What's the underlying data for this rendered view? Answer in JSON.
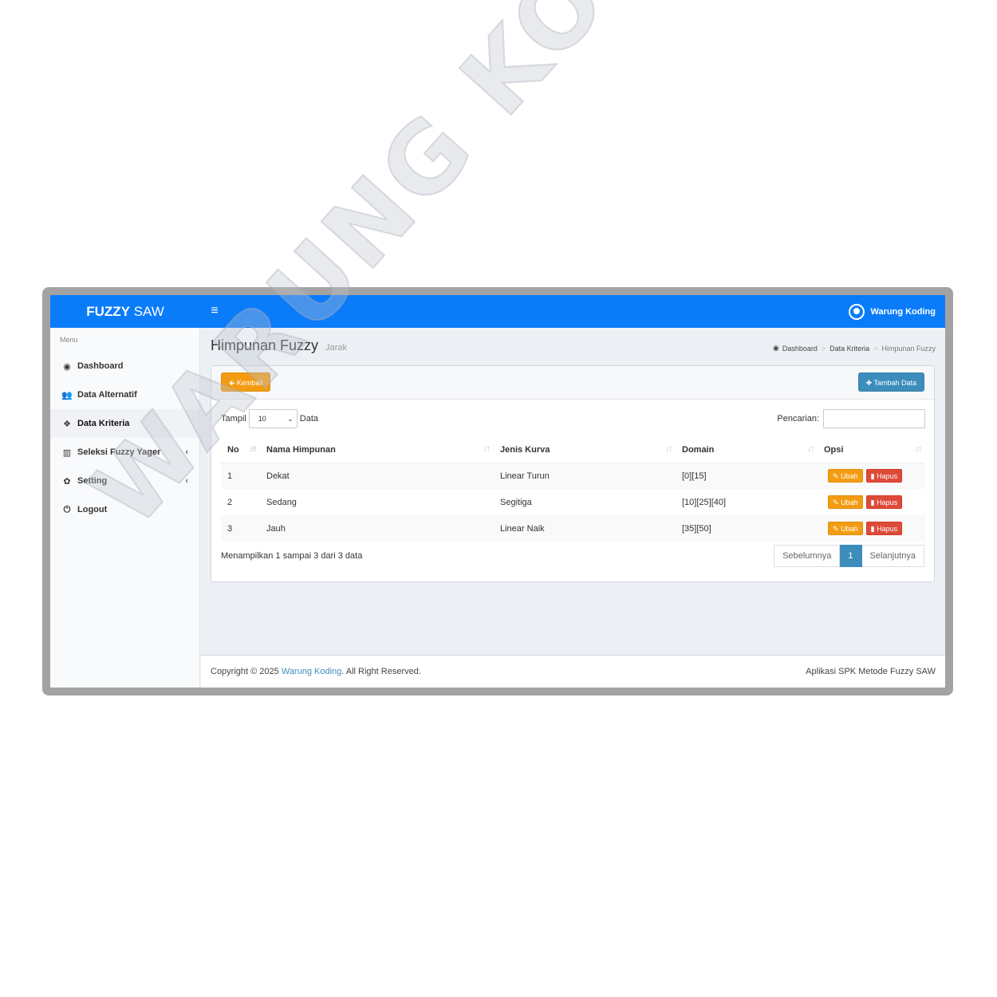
{
  "app": {
    "logo_bold": "FUZZY",
    "logo_rest": " SAW",
    "user_name": "Warung Koding"
  },
  "sidebar": {
    "header": "Menu",
    "items": [
      {
        "label": "Dashboard",
        "icon": "dashboard-icon"
      },
      {
        "label": "Data Alternatif",
        "icon": "users-icon"
      },
      {
        "label": "Data Kriteria",
        "icon": "cubes-icon",
        "active": true
      },
      {
        "label": "Seleksi Fuzzy Yager",
        "icon": "bar-chart-icon",
        "expandable": true
      },
      {
        "label": "Setting",
        "icon": "gear-icon",
        "expandable": true
      },
      {
        "label": "Logout",
        "icon": "power-icon"
      }
    ]
  },
  "page": {
    "title": "Himpunan Fuzzy",
    "subtitle": "Jarak",
    "breadcrumb": [
      "Dashboard",
      "Data Kriteria",
      "Himpunan Fuzzy"
    ]
  },
  "box": {
    "back_label": "Kembali",
    "add_label": "Tambah Data",
    "show_label": "Tampil",
    "page_length": "10",
    "data_label": "Data",
    "search_label": "Pencarian:",
    "search_value": ""
  },
  "table": {
    "headers": [
      "No",
      "Nama Himpunan",
      "Jenis Kurva",
      "Domain",
      "Opsi"
    ],
    "rows": [
      {
        "no": "1",
        "nama": "Dekat",
        "kurva": "Linear Turun",
        "domain": "[0][15]"
      },
      {
        "no": "2",
        "nama": "Sedang",
        "kurva": "Segitiga",
        "domain": "[10][25][40]"
      },
      {
        "no": "3",
        "nama": "Jauh",
        "kurva": "Linear Naik",
        "domain": "[35][50]"
      }
    ],
    "edit_label": "Ubah",
    "delete_label": "Hapus"
  },
  "info": "Menampilkan 1 sampai 3 dari 3 data",
  "pagination": {
    "prev": "Sebelumnya",
    "current": "1",
    "next": "Selanjutnya"
  },
  "footer": {
    "copyright_prefix": "Copyright © 2025 ",
    "copyright_link": "Warung Koding",
    "copyright_suffix": ". All Right Reserved.",
    "right": "Aplikasi SPK Metode Fuzzy SAW"
  },
  "watermark": "WARUNG KODING",
  "colors": {
    "topbar": "#0a7cfa",
    "primary": "#3c8dbc",
    "warning": "#f39c12",
    "danger": "#dd4b39"
  }
}
